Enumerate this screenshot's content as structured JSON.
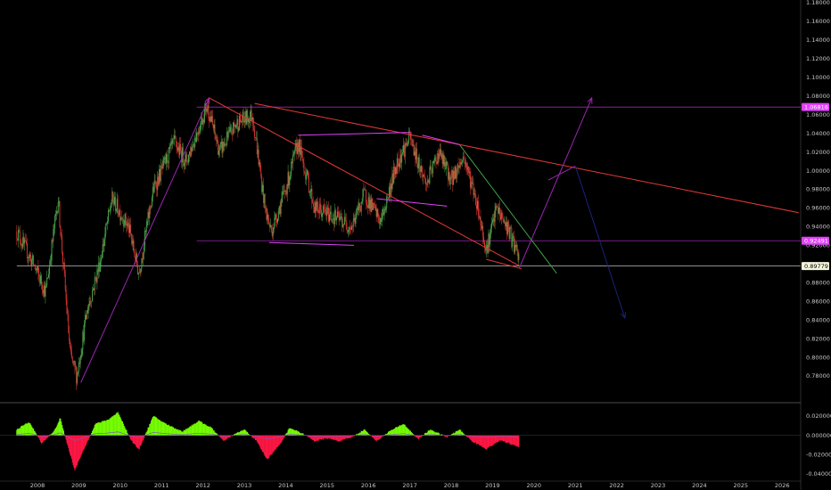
{
  "chart_data": [
    {
      "type": "candlestick",
      "panel": "price",
      "ylim": [
        0.76,
        1.18
      ],
      "y_ticks": [
        "1.18000",
        "1.16000",
        "1.14000",
        "1.12000",
        "1.10000",
        "1.08000",
        "1.06000",
        "1.04000",
        "1.02000",
        "1.00000",
        "0.98000",
        "0.96000",
        "0.94000",
        "0.92000",
        "0.88000",
        "0.86000",
        "0.84000",
        "0.82000",
        "0.80000",
        "0.78000"
      ],
      "x_range": [
        2007.5,
        2026.5
      ],
      "x_ticks": [
        "2008",
        "2009",
        "2010",
        "2011",
        "2012",
        "2013",
        "2014",
        "2015",
        "2016",
        "2017",
        "2018",
        "2019",
        "2020",
        "2021",
        "2022",
        "2023",
        "2024",
        "2025",
        "2026"
      ],
      "key_points": [
        {
          "t": 2007.5,
          "p": 0.935
        },
        {
          "t": 2007.9,
          "p": 0.9
        },
        {
          "t": 2008.2,
          "p": 0.87
        },
        {
          "t": 2008.5,
          "p": 0.97
        },
        {
          "t": 2008.8,
          "p": 0.8
        },
        {
          "t": 2008.95,
          "p": 0.78
        },
        {
          "t": 2009.2,
          "p": 0.85
        },
        {
          "t": 2009.5,
          "p": 0.9
        },
        {
          "t": 2009.8,
          "p": 0.97
        },
        {
          "t": 2010.2,
          "p": 0.94
        },
        {
          "t": 2010.45,
          "p": 0.89
        },
        {
          "t": 2010.8,
          "p": 0.98
        },
        {
          "t": 2011.3,
          "p": 1.03
        },
        {
          "t": 2011.6,
          "p": 1.01
        },
        {
          "t": 2012.1,
          "p": 1.07
        },
        {
          "t": 2012.4,
          "p": 1.02
        },
        {
          "t": 2012.8,
          "p": 1.05
        },
        {
          "t": 2013.2,
          "p": 1.06
        },
        {
          "t": 2013.5,
          "p": 0.96
        },
        {
          "t": 2013.65,
          "p": 0.935
        },
        {
          "t": 2014.0,
          "p": 0.98
        },
        {
          "t": 2014.3,
          "p": 1.03
        },
        {
          "t": 2014.7,
          "p": 0.96
        },
        {
          "t": 2015.2,
          "p": 0.95
        },
        {
          "t": 2015.6,
          "p": 0.94
        },
        {
          "t": 2015.9,
          "p": 0.975
        },
        {
          "t": 2016.3,
          "p": 0.945
        },
        {
          "t": 2016.7,
          "p": 1.01
        },
        {
          "t": 2017.0,
          "p": 1.035
        },
        {
          "t": 2017.4,
          "p": 0.985
        },
        {
          "t": 2017.7,
          "p": 1.02
        },
        {
          "t": 2018.0,
          "p": 0.99
        },
        {
          "t": 2018.3,
          "p": 1.015
        },
        {
          "t": 2018.6,
          "p": 0.97
        },
        {
          "t": 2018.85,
          "p": 0.915
        },
        {
          "t": 2019.1,
          "p": 0.96
        },
        {
          "t": 2019.4,
          "p": 0.935
        },
        {
          "t": 2019.65,
          "p": 0.903
        }
      ],
      "price_labels": [
        {
          "text": "1.06816",
          "value": 1.06816,
          "bg": "#e040fb",
          "fg": "#ffffff"
        },
        {
          "text": "0.92491",
          "value": 0.92491,
          "bg": "#e040fb",
          "fg": "#ffffff"
        },
        {
          "text": "0.89779",
          "value": 0.89779,
          "bg": "#f5f5dc",
          "fg": "#000000"
        }
      ],
      "horizontal_lines": [
        {
          "value": 1.06816,
          "from": 2011.85,
          "color": "#9c27b0"
        },
        {
          "value": 0.92491,
          "from": 2011.85,
          "color": "#9c27b0"
        },
        {
          "value": 0.89779,
          "from": 2007.5,
          "color": "#bdbdbd"
        }
      ],
      "trend_lines": [
        {
          "from": [
            2009.05,
            0.773
          ],
          "to": [
            2012.15,
            1.078
          ],
          "color": "#9c27b0",
          "arrow": true
        },
        {
          "from": [
            2012.15,
            1.078
          ],
          "to": [
            2019.65,
            0.898
          ],
          "color": "#e53935"
        },
        {
          "from": [
            2013.25,
            1.072
          ],
          "to": [
            2026.4,
            0.955
          ],
          "color": "#e53935"
        },
        {
          "from": [
            2014.3,
            1.038
          ],
          "to": [
            2017.0,
            1.041
          ],
          "color": "#e040fb"
        },
        {
          "from": [
            2017.3,
            1.038
          ],
          "to": [
            2018.2,
            1.028
          ],
          "color": "#e040fb"
        },
        {
          "from": [
            2013.6,
            0.923
          ],
          "to": [
            2015.65,
            0.92
          ],
          "color": "#e040fb"
        },
        {
          "from": [
            2016.2,
            0.97
          ],
          "to": [
            2017.9,
            0.962
          ],
          "color": "#e040fb"
        },
        {
          "from": [
            2018.2,
            1.028
          ],
          "to": [
            2020.55,
            0.89
          ],
          "color": "#43a047"
        },
        {
          "from": [
            2019.65,
            0.896
          ],
          "to": [
            2021.4,
            1.078
          ],
          "color": "#9c27b0",
          "arrow": true
        },
        {
          "from": [
            2020.35,
            0.99
          ],
          "to": [
            2021.0,
            1.005
          ],
          "color": "#9c27b0"
        },
        {
          "from": [
            2021.0,
            1.005
          ],
          "to": [
            2022.2,
            0.842
          ],
          "color": "#1a237e",
          "arrow": true
        },
        {
          "from": [
            2018.85,
            0.905
          ],
          "to": [
            2019.7,
            0.895
          ],
          "color": "#e53935"
        }
      ]
    },
    {
      "type": "histogram",
      "panel": "oscillator",
      "ylim": [
        -0.045,
        0.03
      ],
      "y_ticks": [
        "0.020000",
        "0.000000",
        "-0.020000",
        "-0.040000"
      ],
      "colors": {
        "positive": "#76ff03",
        "negative": "#ff1744"
      },
      "key_points": [
        {
          "t": 2007.5,
          "v": 0.006
        },
        {
          "t": 2007.8,
          "v": 0.014
        },
        {
          "t": 2008.1,
          "v": -0.008
        },
        {
          "t": 2008.4,
          "v": 0.004
        },
        {
          "t": 2008.55,
          "v": 0.018
        },
        {
          "t": 2008.7,
          "v": -0.006
        },
        {
          "t": 2008.9,
          "v": -0.036
        },
        {
          "t": 2009.15,
          "v": -0.012
        },
        {
          "t": 2009.4,
          "v": 0.012
        },
        {
          "t": 2009.7,
          "v": 0.016
        },
        {
          "t": 2009.95,
          "v": 0.024
        },
        {
          "t": 2010.25,
          "v": -0.004
        },
        {
          "t": 2010.45,
          "v": -0.015
        },
        {
          "t": 2010.8,
          "v": 0.02
        },
        {
          "t": 2011.1,
          "v": 0.012
        },
        {
          "t": 2011.5,
          "v": 0.004
        },
        {
          "t": 2011.9,
          "v": 0.015
        },
        {
          "t": 2012.2,
          "v": 0.008
        },
        {
          "t": 2012.5,
          "v": -0.006
        },
        {
          "t": 2012.8,
          "v": 0.002
        },
        {
          "t": 2013.0,
          "v": 0.006
        },
        {
          "t": 2013.3,
          "v": -0.006
        },
        {
          "t": 2013.55,
          "v": -0.025
        },
        {
          "t": 2013.85,
          "v": -0.01
        },
        {
          "t": 2014.1,
          "v": 0.008
        },
        {
          "t": 2014.4,
          "v": 0.002
        },
        {
          "t": 2014.7,
          "v": -0.006
        },
        {
          "t": 2015.0,
          "v": -0.003
        },
        {
          "t": 2015.3,
          "v": -0.006
        },
        {
          "t": 2015.6,
          "v": -0.002
        },
        {
          "t": 2015.9,
          "v": 0.006
        },
        {
          "t": 2016.2,
          "v": -0.006
        },
        {
          "t": 2016.5,
          "v": 0.004
        },
        {
          "t": 2016.85,
          "v": 0.012
        },
        {
          "t": 2017.2,
          "v": -0.004
        },
        {
          "t": 2017.5,
          "v": 0.006
        },
        {
          "t": 2017.9,
          "v": -0.002
        },
        {
          "t": 2018.2,
          "v": 0.006
        },
        {
          "t": 2018.5,
          "v": -0.006
        },
        {
          "t": 2018.85,
          "v": -0.014
        },
        {
          "t": 2019.2,
          "v": -0.005
        },
        {
          "t": 2019.5,
          "v": -0.01
        },
        {
          "t": 2019.65,
          "v": -0.012
        }
      ]
    }
  ]
}
